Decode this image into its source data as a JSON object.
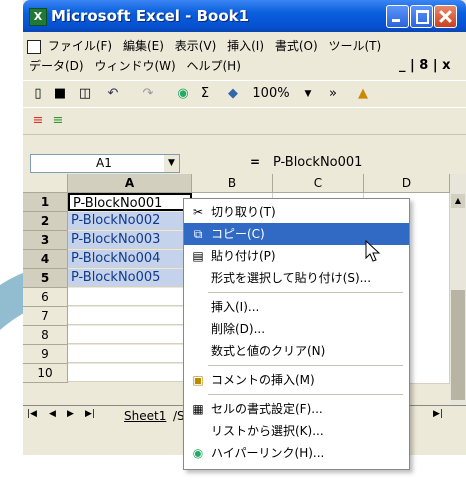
{
  "window": {
    "title": "Microsoft Excel - Book1",
    "app_icon": "X"
  },
  "menu": {
    "row1": [
      "ファイル(F)",
      "編集(E)",
      "表示(V)",
      "挿入(I)",
      "書式(O)",
      "ツール(T)"
    ],
    "row2": [
      "データ(D)",
      "ウィンドウ(W)",
      "ヘルプ(H)"
    ],
    "mdi_controls": "_ | 8 | x"
  },
  "toolbar": {
    "zoom": "100%",
    "sigma": "Σ",
    "more": "»"
  },
  "formula_bar": {
    "name_box": "A1",
    "equals": "=",
    "formula": "P-BlockNo001"
  },
  "columns": [
    "A",
    "B",
    "C",
    "D"
  ],
  "rows": [
    "1",
    "2",
    "3",
    "4",
    "5",
    "6",
    "7",
    "8",
    "9",
    "10"
  ],
  "cells": [
    "P-BlockNo001",
    "P-BlockNo002",
    "P-BlockNo003",
    "P-BlockNo004",
    "P-BlockNo005"
  ],
  "sheet_tab": {
    "label": "Sheet1",
    "sep": "/S"
  },
  "context_menu": {
    "items": [
      {
        "label": "切り取り(T)",
        "icon": "scissors-icon"
      },
      {
        "label": "コピー(C)",
        "icon": "copy-icon",
        "highlighted": true
      },
      {
        "label": "貼り付け(P)",
        "icon": "paste-icon"
      },
      {
        "label": "形式を選択して貼り付け(S)...",
        "icon": ""
      },
      {
        "label": "挿入(I)...",
        "icon": ""
      },
      {
        "label": "削除(D)...",
        "icon": ""
      },
      {
        "label": "数式と値のクリア(N)",
        "icon": ""
      },
      {
        "label": "コメントの挿入(M)",
        "icon": "comment-icon"
      },
      {
        "label": "セルの書式設定(F)...",
        "icon": "format-cells-icon"
      },
      {
        "label": "リストから選択(K)...",
        "icon": ""
      },
      {
        "label": "ハイパーリンク(H)...",
        "icon": "hyperlink-icon"
      }
    ]
  },
  "colors": {
    "title_bar": "#0a5fdc",
    "selection": "#c5d2eb",
    "menu_highlight": "#316ac5",
    "swoosh": "#7fb2c9"
  }
}
